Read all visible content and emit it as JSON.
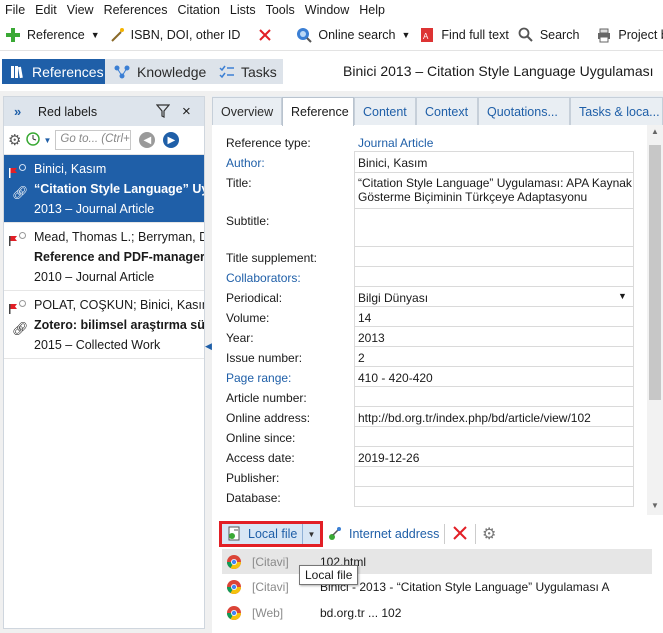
{
  "menu": [
    "File",
    "Edit",
    "View",
    "References",
    "Citation",
    "Lists",
    "Tools",
    "Window",
    "Help"
  ],
  "toolbar": {
    "reference_label": "Reference",
    "isbn_label": "ISBN, DOI, other ID",
    "online_search_label": "Online search",
    "find_full_text_label": "Find full text",
    "search_label": "Search",
    "project_label": "Project bib"
  },
  "modes": {
    "references": "References",
    "knowledge": "Knowledge",
    "tasks": "Tasks"
  },
  "window_title": "Binici 2013 – Citation Style Language Uygulaması",
  "left_panel": {
    "header": "Red labels",
    "goto_placeholder": "Go to... (Ctrl+",
    "items": [
      {
        "authors": "Binici, Kasım",
        "title": "“Citation Style Language” Uy",
        "meta": "2013 – Journal Article"
      },
      {
        "authors": "Mead, Thomas L.; Berryman, D",
        "title": "Reference and PDF-manager",
        "meta": "2010 – Journal Article"
      },
      {
        "authors": "POLAT, COŞKUN; Binici, Kasım",
        "title": "Zotero: bilimsel araştırma sür",
        "meta": "2015 – Collected Work"
      }
    ]
  },
  "tabs": [
    "Overview",
    "Reference",
    "Content",
    "Context",
    "Quotations...",
    "Tasks & loca..."
  ],
  "form": {
    "reference_type_label": "Reference type:",
    "reference_type_value": "Journal Article",
    "author_label": "Author:",
    "author_value": "Binici, Kasım",
    "title_label": "Title:",
    "title_value_line1": "“Citation Style Language” Uygulaması: APA Kaynak",
    "title_value_line2": "Gösterme Biçiminin Türkçeye Adaptasyonu",
    "subtitle_label": "Subtitle:",
    "title_supplement_label": "Title supplement:",
    "collaborators_label": "Collaborators:",
    "periodical_label": "Periodical:",
    "periodical_value": "Bilgi Dünyası",
    "volume_label": "Volume:",
    "volume_value": "14",
    "year_label": "Year:",
    "year_value": "2013",
    "issue_label": "Issue number:",
    "issue_value": "2",
    "page_range_label": "Page range:",
    "page_range_value": "410 - 420-420",
    "article_number_label": "Article number:",
    "online_address_label": "Online address:",
    "online_address_value": "http://bd.org.tr/index.php/bd/article/view/102",
    "online_since_label": "Online since:",
    "access_date_label": "Access date:",
    "access_date_value": "2019-12-26",
    "publisher_label": "Publisher:",
    "database_label": "Database:"
  },
  "attachments": {
    "local_file_label": "Local file",
    "internet_address_label": "Internet address",
    "items": [
      {
        "type": "[Citavi]",
        "name": "102.html"
      },
      {
        "type": "[Citavi]",
        "name": "Binici - 2013 - “Citation Style Language” Uygulaması A"
      },
      {
        "type": "[Web]",
        "name": "bd.org.tr ... 102"
      }
    ],
    "tooltip": "Local file"
  },
  "colors": {
    "accent": "#1f5fa8",
    "highlight_border": "#e21f26"
  }
}
